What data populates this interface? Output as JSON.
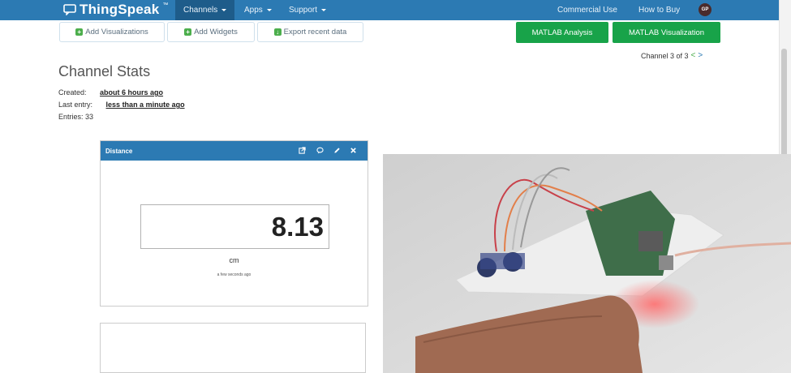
{
  "navbar": {
    "brand": "ThingSpeak",
    "brand_tm": "™",
    "items": [
      {
        "label": "Channels",
        "active": true
      },
      {
        "label": "Apps",
        "active": false
      },
      {
        "label": "Support",
        "active": false
      }
    ],
    "right_links": [
      "Commercial Use",
      "How to Buy"
    ],
    "avatar_initials": "GP"
  },
  "toolbar": {
    "buttons": [
      "Add Visualizations",
      "Add Widgets",
      "Export recent data"
    ],
    "matlab_buttons": [
      "MATLAB Analysis",
      "MATLAB Visualization"
    ]
  },
  "channel_nav": {
    "label": "Channel 3 of 3",
    "prev": "<",
    "next": ">"
  },
  "stats": {
    "title": "Channel Stats",
    "created_label": "Created:",
    "created_value": "about 6 hours ago",
    "last_entry_label": "Last entry:",
    "last_entry_value": "less than a minute ago",
    "entries_label": "Entries: 33"
  },
  "widget": {
    "title": "Distance",
    "value": "8.13",
    "unit": "cm",
    "updated": "a few seconds ago"
  },
  "colors": {
    "navbar": "#2c7ab3",
    "green_button": "#18a349"
  }
}
